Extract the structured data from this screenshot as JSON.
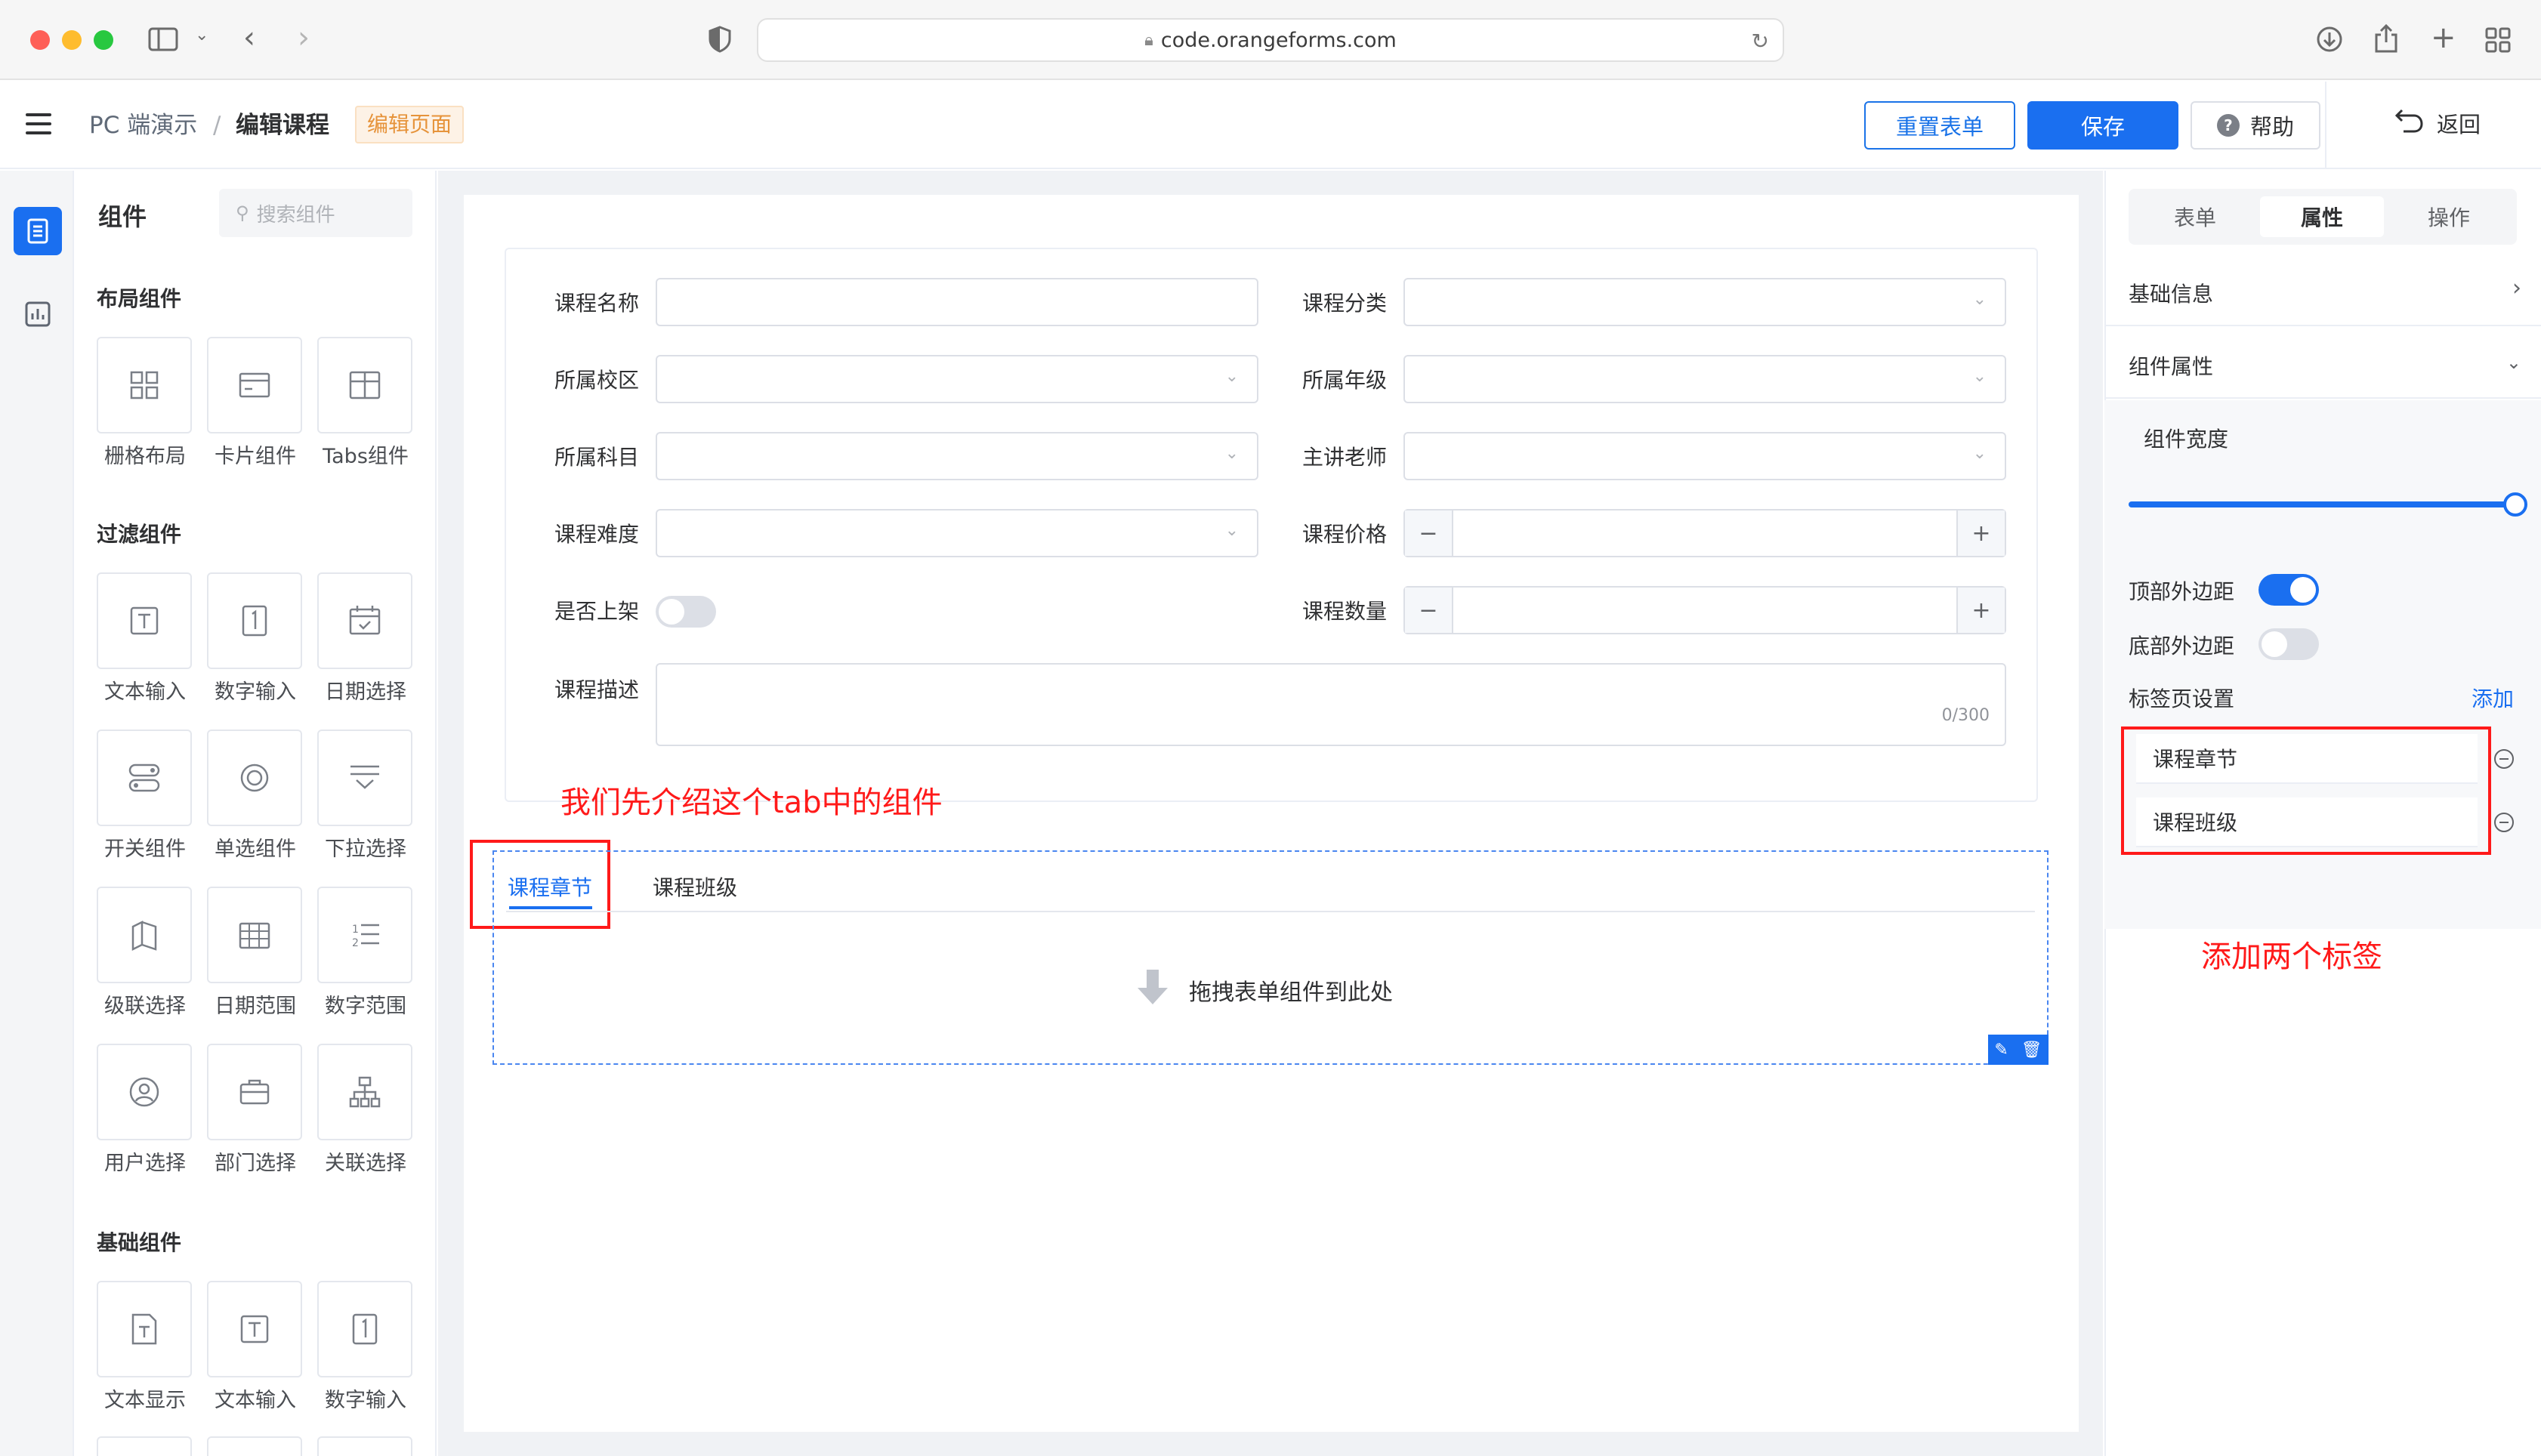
{
  "browser": {
    "url": "code.orangeforms.com"
  },
  "header": {
    "breadcrumb_root": "PC 端演示",
    "breadcrumb_sep": "/",
    "breadcrumb_current": "编辑课程",
    "page_tag": "编辑页面",
    "reset_label": "重置表单",
    "save_label": "保存",
    "help_label": "帮助",
    "back_label": "返回"
  },
  "palette": {
    "title": "组件",
    "search_placeholder": "搜索组件",
    "groups": [
      {
        "title": "布局组件",
        "items": [
          {
            "label": "栅格布局",
            "icon": "grid-layout-icon"
          },
          {
            "label": "卡片组件",
            "icon": "card-icon"
          },
          {
            "label": "Tabs组件",
            "icon": "tabs-icon"
          }
        ]
      },
      {
        "title": "过滤组件",
        "items": [
          {
            "label": "文本输入",
            "icon": "text-input-icon"
          },
          {
            "label": "数字输入",
            "icon": "number-input-icon"
          },
          {
            "label": "日期选择",
            "icon": "calendar-icon"
          },
          {
            "label": "开关组件",
            "icon": "switch-icon"
          },
          {
            "label": "单选组件",
            "icon": "radio-icon"
          },
          {
            "label": "下拉选择",
            "icon": "dropdown-icon"
          },
          {
            "label": "级联选择",
            "icon": "cascader-icon"
          },
          {
            "label": "日期范围",
            "icon": "date-range-icon"
          },
          {
            "label": "数字范围",
            "icon": "number-range-icon"
          },
          {
            "label": "用户选择",
            "icon": "user-icon"
          },
          {
            "label": "部门选择",
            "icon": "department-icon"
          },
          {
            "label": "关联选择",
            "icon": "relation-icon"
          }
        ]
      },
      {
        "title": "基础组件",
        "items": [
          {
            "label": "文本显示",
            "icon": "text-display-icon"
          },
          {
            "label": "文本输入",
            "icon": "text-input-icon"
          },
          {
            "label": "数字输入",
            "icon": "number-input-icon"
          }
        ]
      }
    ]
  },
  "form": {
    "fields": {
      "course_name": "课程名称",
      "course_category": "课程分类",
      "campus": "所属校区",
      "grade": "所属年级",
      "subject": "所属科目",
      "teacher": "主讲老师",
      "difficulty": "课程难度",
      "price": "课程价格",
      "on_shelf": "是否上架",
      "quantity": "课程数量",
      "description": "课程描述"
    },
    "description_counter": "0/300"
  },
  "annotations": {
    "intro_text": "我们先介绍这个tab中的组件",
    "add_tabs_text": "添加两个标签"
  },
  "tabs_component": {
    "tabs": [
      "课程章节",
      "课程班级"
    ],
    "active_tab": "课程章节",
    "drop_hint": "拖拽表单组件到此处"
  },
  "properties": {
    "tabs": [
      "表单",
      "属性",
      "操作"
    ],
    "active_tab": "属性",
    "basic_info": "基础信息",
    "component_props": "组件属性",
    "width_label": "组件宽度",
    "width_value": 1.0,
    "top_margin_label": "顶部外边距",
    "top_margin_on": true,
    "bottom_margin_label": "底部外边距",
    "bottom_margin_on": false,
    "tab_settings_label": "标签页设置",
    "add_label": "添加",
    "tab_items": [
      "课程章节",
      "课程班级"
    ]
  },
  "colors": {
    "primary": "#1a6ff0",
    "annotation": "#ff1a1a",
    "tag_orange": "#e6933a"
  }
}
